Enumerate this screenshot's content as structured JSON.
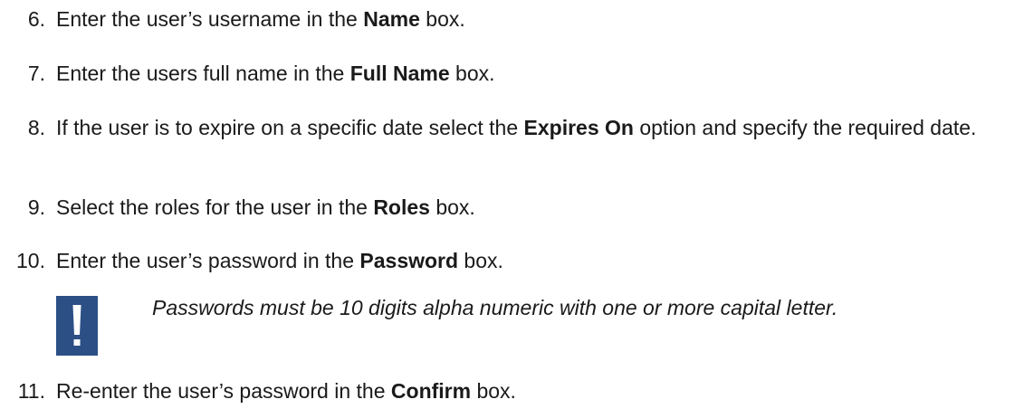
{
  "steps": [
    {
      "number": "6.",
      "before": "Enter the user’s username in the ",
      "bold": "Name",
      "after": " box."
    },
    {
      "number": "7.",
      "before": "Enter the users full name in the ",
      "bold": "Full Name",
      "after": " box."
    },
    {
      "number": "8.",
      "before": "If the user is to expire on a specific date select the ",
      "bold": "Expires On",
      "after": " option and specify the required date."
    },
    {
      "number": "9.",
      "before": "Select the roles for the user in the ",
      "bold": "Roles",
      "after": " box."
    },
    {
      "number": "10.",
      "before": "Enter the user’s password in the ",
      "bold": "Password",
      "after": " box."
    },
    {
      "number": "11.",
      "before": "Re-enter the user’s password in the ",
      "bold": "Confirm",
      "after": " box."
    }
  ],
  "note": {
    "icon": "exclamation-icon",
    "icon_color": "#2c4f86",
    "text": "Passwords must be 10 digits alpha numeric with one or more capital letter."
  }
}
